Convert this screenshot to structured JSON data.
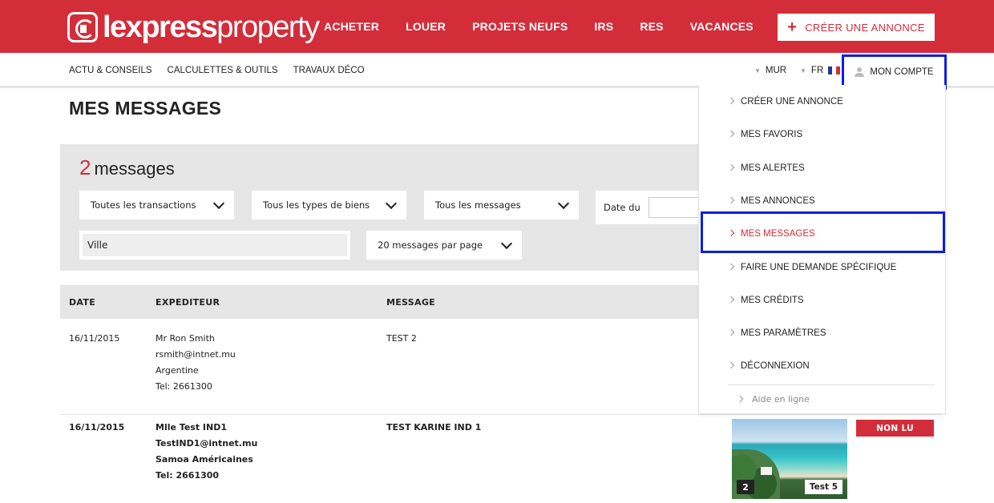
{
  "brand": {
    "logo_bold": "lexpress",
    "logo_light": "property",
    "accent": "#d42d3a"
  },
  "main_nav": [
    "ACHETER",
    "LOUER",
    "PROJETS NEUFS",
    "IRS",
    "RES",
    "VACANCES"
  ],
  "create_button": {
    "icon": "+",
    "label": "CRÉER UNE ANNONCE"
  },
  "sub_nav": [
    "ACTU & CONSEILS",
    "CALCULETTES & OUTILS",
    "TRAVAUX DÉCO"
  ],
  "utility": {
    "currency": "MUR",
    "language": "FR",
    "account": "MON COMPTE"
  },
  "page_title": "MES MESSAGES",
  "filters": {
    "count": "2",
    "count_label": "messages",
    "transactions": "Toutes les transactions",
    "property_types": "Tous les types de biens",
    "messages": "Tous les messages",
    "date_label": "Date du",
    "city_placeholder": "Ville",
    "per_page": "20 messages par page"
  },
  "table": {
    "headers": [
      "DATE",
      "EXPEDITEUR",
      "MESSAGE"
    ],
    "rows": [
      {
        "date": "16/11/2015",
        "sender_name": "Mr Ron Smith",
        "sender_email": "rsmith@intnet.mu",
        "sender_country": "Argentine",
        "sender_tel": "Tel: 2661300",
        "message": "TEST 2",
        "unread": false
      },
      {
        "date": "16/11/2015",
        "sender_name": "Mlle Test IND1",
        "sender_email": "TestIND1@intnet.mu",
        "sender_country": "Samoa Américaines",
        "sender_tel": "Tel: 2661300",
        "message": "TEST KARINE IND 1",
        "unread": true,
        "unread_label": "NON LU",
        "thumb_count": "2",
        "thumb_label": "Test 5"
      }
    ]
  },
  "account_menu": {
    "items": [
      "CRÉER UNE ANNONCE",
      "MES FAVORIS",
      "MES ALERTES",
      "MES ANNONCES",
      "MES MESSAGES",
      "FAIRE UNE DEMANDE SPÉCIFIQUE",
      "MES CRÉDITS",
      "MES PARAMÈTRES",
      "DÉCONNEXION"
    ],
    "active_index": 4,
    "help": "Aide en ligne"
  }
}
